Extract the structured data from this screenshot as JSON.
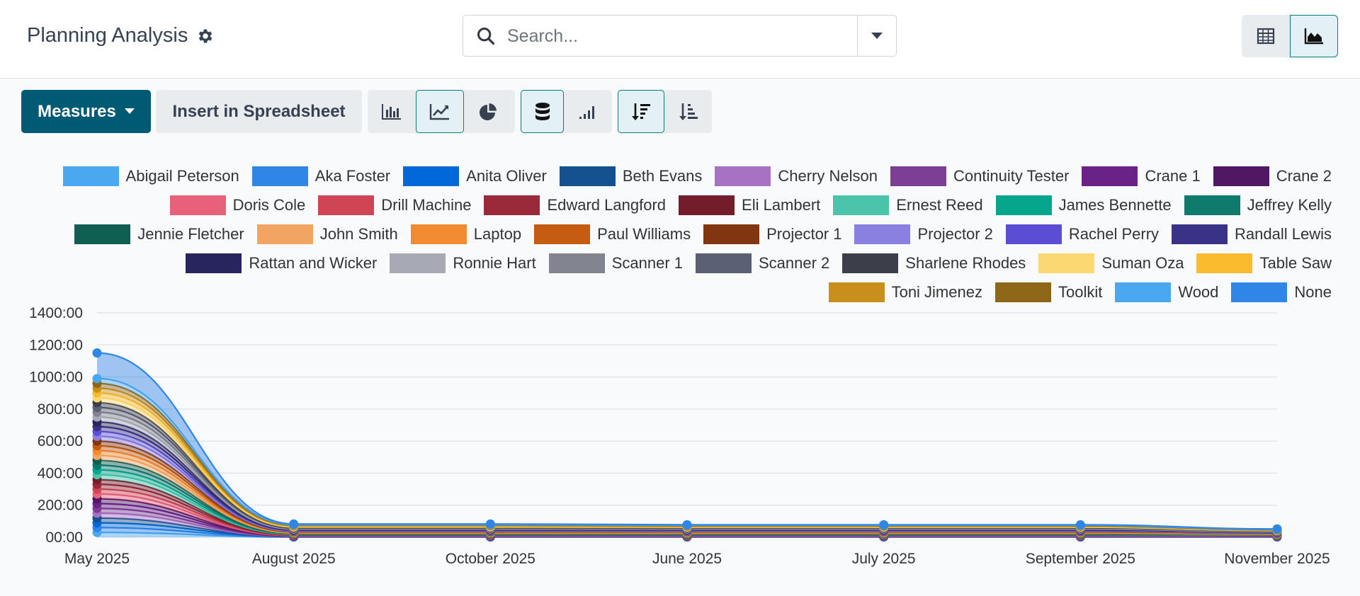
{
  "header": {
    "title": "Planning Analysis",
    "search_placeholder": "Search..."
  },
  "toolbar": {
    "measures_label": "Measures",
    "insert_label": "Insert in Spreadsheet"
  },
  "icons": {
    "gear": "gear-icon",
    "search": "search-icon",
    "dropdown": "caret-down-icon",
    "pivot_view": "table-grid-icon",
    "graph_view": "area-chart-icon",
    "bar_chart": "bar-chart-icon",
    "line_chart": "line-chart-icon",
    "pie_chart": "pie-chart-icon",
    "stacked": "database-stack-icon",
    "cumulative": "signal-bars-icon",
    "sort_desc": "sort-descending-icon",
    "sort_asc": "sort-ascending-icon"
  },
  "colors": {
    "primary": "#015a74",
    "accent": "#017e84"
  },
  "chart_data": {
    "type": "area",
    "stacked": true,
    "categories": [
      "May 2025",
      "August 2025",
      "October 2025",
      "June 2025",
      "July 2025",
      "September 2025",
      "November 2025"
    ],
    "y_ticks": [
      "00:00",
      "200:00",
      "400:00",
      "600:00",
      "800:00",
      "1000:00",
      "1200:00",
      "1400:00"
    ],
    "ylim": [
      0,
      1400
    ],
    "grid": true,
    "legend_position": "top-right",
    "series": [
      {
        "name": "Abigail Peterson",
        "color": "#4aa8f0",
        "values": [
          30,
          1,
          1,
          1,
          1,
          1,
          1
        ]
      },
      {
        "name": "Aka Foster",
        "color": "#3086e6",
        "values": [
          30,
          1,
          1,
          1,
          1,
          1,
          1
        ]
      },
      {
        "name": "Anita Oliver",
        "color": "#0068d8",
        "values": [
          30,
          1,
          1,
          1,
          1,
          1,
          1
        ]
      },
      {
        "name": "Beth Evans",
        "color": "#15508f",
        "values": [
          30,
          1,
          1,
          1,
          1,
          1,
          1
        ]
      },
      {
        "name": "Cherry Nelson",
        "color": "#a872c4",
        "values": [
          30,
          1,
          1,
          1,
          1,
          1,
          1
        ]
      },
      {
        "name": "Continuity Tester",
        "color": "#7c3f95",
        "values": [
          30,
          1,
          1,
          1,
          1,
          1,
          1
        ]
      },
      {
        "name": "Crane 1",
        "color": "#6a2188",
        "values": [
          30,
          1,
          1,
          1,
          1,
          1,
          1
        ]
      },
      {
        "name": "Crane 2",
        "color": "#501763",
        "values": [
          30,
          1,
          1,
          1,
          1,
          1,
          1
        ]
      },
      {
        "name": "Doris Cole",
        "color": "#e9607a",
        "values": [
          30,
          2,
          2,
          2,
          2,
          2,
          1
        ]
      },
      {
        "name": "Drill Machine",
        "color": "#cf4556",
        "values": [
          30,
          2,
          2,
          2,
          2,
          2,
          1
        ]
      },
      {
        "name": "Edward Langford",
        "color": "#9a2a39",
        "values": [
          30,
          2,
          2,
          2,
          2,
          2,
          1
        ]
      },
      {
        "name": "Eli Lambert",
        "color": "#731c2a",
        "values": [
          30,
          2,
          2,
          2,
          2,
          2,
          1
        ]
      },
      {
        "name": "Ernest Reed",
        "color": "#4ac4ab",
        "values": [
          30,
          2,
          2,
          2,
          2,
          2,
          1
        ]
      },
      {
        "name": "James Bennette",
        "color": "#05a58c",
        "values": [
          30,
          2,
          2,
          2,
          2,
          2,
          1
        ]
      },
      {
        "name": "Jeffrey Kelly",
        "color": "#0f7b6d",
        "values": [
          30,
          2,
          2,
          2,
          2,
          2,
          1
        ]
      },
      {
        "name": "Jennie Fletcher",
        "color": "#0e5e52",
        "values": [
          30,
          2,
          2,
          2,
          2,
          2,
          1
        ]
      },
      {
        "name": "John Smith",
        "color": "#f2a462",
        "values": [
          30,
          3,
          3,
          3,
          3,
          3,
          2
        ]
      },
      {
        "name": "Laptop",
        "color": "#f28a32",
        "values": [
          30,
          3,
          3,
          3,
          3,
          3,
          2
        ]
      },
      {
        "name": "Paul Williams",
        "color": "#c55c12",
        "values": [
          30,
          3,
          3,
          3,
          3,
          3,
          2
        ]
      },
      {
        "name": "Projector 1",
        "color": "#82360f",
        "values": [
          30,
          3,
          3,
          3,
          3,
          3,
          2
        ]
      },
      {
        "name": "Projector 2",
        "color": "#8a80e0",
        "values": [
          30,
          3,
          3,
          3,
          3,
          3,
          2
        ]
      },
      {
        "name": "Rachel Perry",
        "color": "#5a4fd4",
        "values": [
          30,
          3,
          3,
          3,
          3,
          3,
          2
        ]
      },
      {
        "name": "Randall Lewis",
        "color": "#3a3286",
        "values": [
          30,
          3,
          3,
          3,
          3,
          3,
          2
        ]
      },
      {
        "name": "Rattan and Wicker",
        "color": "#28245e",
        "values": [
          30,
          3,
          3,
          3,
          3,
          3,
          2
        ]
      },
      {
        "name": "Ronnie Hart",
        "color": "#a7a9b5",
        "values": [
          30,
          3,
          3,
          3,
          3,
          3,
          2
        ]
      },
      {
        "name": "Scanner 1",
        "color": "#81838f",
        "values": [
          30,
          3,
          3,
          3,
          3,
          3,
          2
        ]
      },
      {
        "name": "Scanner 2",
        "color": "#5a5f73",
        "values": [
          30,
          3,
          3,
          3,
          3,
          3,
          2
        ]
      },
      {
        "name": "Sharlene Rhodes",
        "color": "#3c3f4a",
        "values": [
          30,
          3,
          3,
          3,
          3,
          3,
          2
        ]
      },
      {
        "name": "Suman Oza",
        "color": "#fcd872",
        "values": [
          30,
          4,
          4,
          3,
          3,
          3,
          2
        ]
      },
      {
        "name": "Table Saw",
        "color": "#fbbb2e",
        "values": [
          30,
          4,
          4,
          3,
          3,
          3,
          2
        ]
      },
      {
        "name": "Toni Jimenez",
        "color": "#c8901a",
        "values": [
          30,
          4,
          4,
          3,
          3,
          3,
          2
        ]
      },
      {
        "name": "Toolkit",
        "color": "#8e6618",
        "values": [
          30,
          4,
          4,
          3,
          3,
          3,
          2
        ]
      },
      {
        "name": "Wood",
        "color": "#4aa8f0",
        "values": [
          30,
          3,
          3,
          3,
          3,
          3,
          2
        ]
      },
      {
        "name": "None",
        "color": "#3086e6",
        "values": [
          160,
          4,
          4,
          3,
          3,
          3,
          2
        ]
      }
    ]
  }
}
